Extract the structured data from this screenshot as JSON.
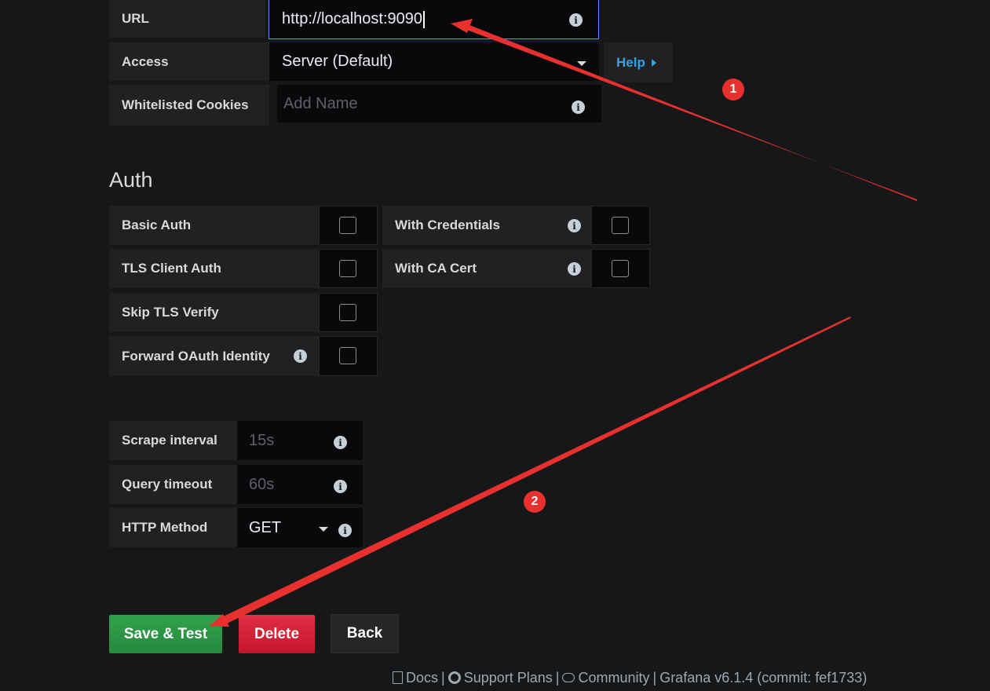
{
  "http": {
    "url_label": "URL",
    "url_value": "http://localhost:9090",
    "access_label": "Access",
    "access_value": "Server (Default)",
    "help_label": "Help",
    "cookies_label": "Whitelisted Cookies",
    "cookies_placeholder": "Add Name"
  },
  "auth": {
    "title": "Auth",
    "basic_auth": "Basic Auth",
    "with_credentials": "With Credentials",
    "tls_client_auth": "TLS Client Auth",
    "with_ca_cert": "With CA Cert",
    "skip_tls_verify": "Skip TLS Verify",
    "forward_oauth": "Forward OAuth Identity"
  },
  "prometheus": {
    "scrape_label": "Scrape interval",
    "scrape_placeholder": "15s",
    "query_timeout_label": "Query timeout",
    "query_timeout_placeholder": "60s",
    "http_method_label": "HTTP Method",
    "http_method_value": "GET"
  },
  "buttons": {
    "save_test": "Save & Test",
    "delete": "Delete",
    "back": "Back"
  },
  "footer": {
    "docs": "Docs",
    "support": "Support Plans",
    "community": "Community",
    "version": "Grafana v6.1.4 (commit: fef1733)"
  },
  "annotations": {
    "marker_1": "1",
    "marker_2": "2"
  },
  "colors": {
    "background": "#161719",
    "label_bg": "#212124",
    "input_bg": "#09090b",
    "focus_border": "#5794f2",
    "help_link": "#33a2e5",
    "save_button": "#299c46",
    "delete_button": "#d44a3a",
    "back_button": "#262628",
    "annotation_red": "#e8312f"
  }
}
